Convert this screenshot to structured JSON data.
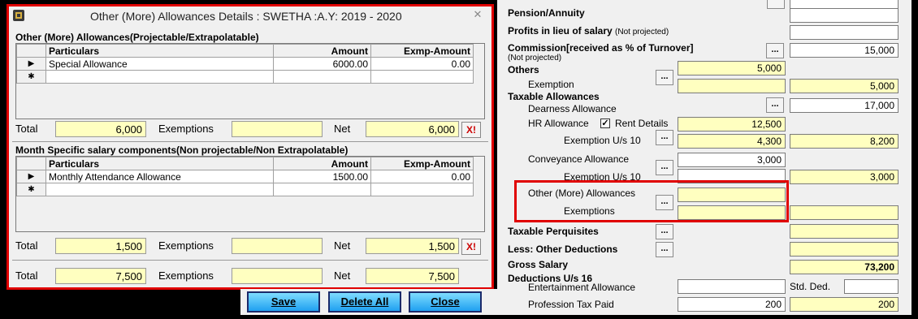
{
  "dialog": {
    "title": "Other (More) Allowances Details : SWETHA :A.Y: 2019 - 2020",
    "section1": {
      "title": "Other (More) Allowances(Projectable/Extrapolatable)",
      "columns": [
        "Particulars",
        "Amount",
        "Exmp-Amount"
      ],
      "rows": [
        {
          "indicator": "▶",
          "particulars": "Special Allowance",
          "amount": "6000.00",
          "exmp": "0.00"
        },
        {
          "indicator": "✱",
          "particulars": "",
          "amount": "",
          "exmp": ""
        }
      ],
      "total_label": "Total",
      "total": "6,000",
      "exemptions_label": "Exemptions",
      "exemptions": "",
      "net_label": "Net",
      "net": "6,000"
    },
    "section2": {
      "title": "Month Specific salary components(Non projectable/Non Extrapolatable)",
      "columns": [
        "Particulars",
        "Amount",
        "Exmp-Amount"
      ],
      "rows": [
        {
          "indicator": "▶",
          "particulars": "Monthly Attendance Allowance",
          "amount": "1500.00",
          "exmp": "0.00"
        },
        {
          "indicator": "✱",
          "particulars": "",
          "amount": "",
          "exmp": ""
        }
      ],
      "total_label": "Total",
      "total": "1,500",
      "exemptions_label": "Exemptions",
      "exemptions": "",
      "net_label": "Net",
      "net": "1,500"
    },
    "grand": {
      "total_label": "Total",
      "total": "7,500",
      "exemptions_label": "Exemptions",
      "exemptions": "",
      "net_label": "Net",
      "net": "7,500"
    },
    "buttons": {
      "save": "Save",
      "delete_all": "Delete All",
      "close": "Close"
    },
    "clear_button": "X!"
  },
  "right": {
    "pension": "Pension/Annuity",
    "profits": "Profits in lieu of salary",
    "profits_note": "(Not projected)",
    "commission": "Commission[received as % of Turnover]",
    "commission_note": "(Not projected)",
    "commission_value": "15,000",
    "others": "Others",
    "others_value": "5,000",
    "exemption": "Exemption",
    "exemption_value": "5,000",
    "taxable_allowances": "Taxable Allowances",
    "dearness": "Dearness Allowance",
    "dearness_value": "17,000",
    "hr": "HR Allowance",
    "rent_details": "Rent Details",
    "hr_value": "12,500",
    "hr_exemption": "Exemption U/s 10",
    "hr_exemption_value": "4,300",
    "hr_net": "8,200",
    "conveyance": "Conveyance Allowance",
    "conveyance_value": "3,000",
    "conv_exemption": "Exemption U/s 10",
    "conv_net": "3,000",
    "other_more": "Other (More) Allowances",
    "other_exemptions": "Exemptions",
    "taxable_perquisites": "Taxable Perquisites",
    "less_other": "Less: Other Deductions",
    "gross_salary": "Gross Salary",
    "gross_value": "73,200",
    "deductions": "Deductions U/s 16",
    "entertainment": "Entertainment Allowance",
    "std_ded": "Std. Ded.",
    "profession_tax": "Profession Tax Paid",
    "profession_value": "200",
    "profession_net": "200",
    "dots": "...",
    "check": "✓"
  }
}
